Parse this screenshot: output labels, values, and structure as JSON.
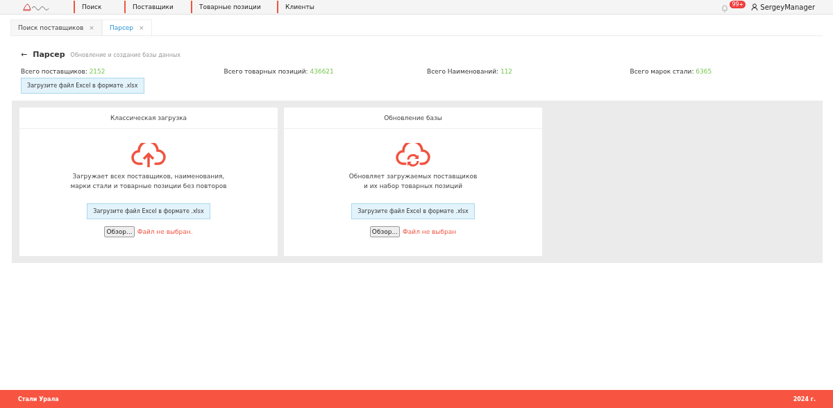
{
  "topbar": {
    "nav": [
      {
        "label": "Поиск"
      },
      {
        "label": "Поставщики"
      },
      {
        "label": "Товарные позиции"
      },
      {
        "label": "Клиенты"
      }
    ],
    "notifications_badge": "99+",
    "user": "SergeyManager"
  },
  "tabs": [
    {
      "label": "Поиск поставщиков",
      "close": "×",
      "selected": false
    },
    {
      "label": "Парсер",
      "close": "×",
      "selected": true
    }
  ],
  "page": {
    "back": "←",
    "title": "Парсер",
    "subtitle": "Обновление и создание базы данных"
  },
  "stats": [
    {
      "label": "Всего поставщиков:",
      "value": "2152"
    },
    {
      "label": "Всего товарных позиций:",
      "value": "436621"
    },
    {
      "label": "Всего Наименований:",
      "value": "112"
    },
    {
      "label": "Всего марок стали:",
      "value": "6365"
    }
  ],
  "top_button": "Загрузите файл Excel в формате .xlsx",
  "cards": [
    {
      "kind": "upload",
      "title": "Классическая загрузка",
      "description": "Загружает всех поставщиков, наименования,\nмарки стали и товарные позиции без повторов",
      "button": "Загрузите файл Excel в формате .xlsx",
      "browse": "Обзор...",
      "file_status": "Файл не выбран."
    },
    {
      "kind": "sync",
      "title": "Обновление базы",
      "description": "Обновляет загружаемых поставщиков\nи их набор товарных позиций",
      "button": "Загрузите файл Excel в формате .xlsx",
      "browse": "Обзор...",
      "file_status": "Файл не выбран"
    }
  ],
  "footer": {
    "left": "Стали Урала",
    "right": "2024 г."
  }
}
